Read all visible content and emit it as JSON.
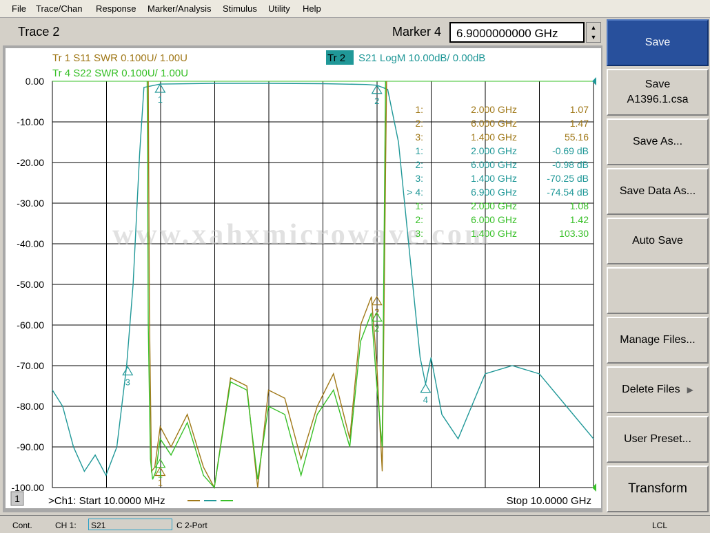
{
  "menu": [
    "File",
    "Trace/Chan",
    "Response",
    "Marker/Analysis",
    "Stimulus",
    "Utility",
    "Help"
  ],
  "header": {
    "trace_title": "Trace 2",
    "marker_label": "Marker 4",
    "marker_value": "6.9000000000 GHz"
  },
  "softkeys": [
    {
      "line1": "Save",
      "line2": ""
    },
    {
      "line1": "Save",
      "line2": "A1396.1.csa"
    },
    {
      "line1": "Save As...",
      "line2": ""
    },
    {
      "line1": "Save Data As...",
      "line2": ""
    },
    {
      "line1": "Auto Save",
      "line2": ""
    },
    {
      "line1": "",
      "line2": ""
    },
    {
      "line1": "Manage Files...",
      "line2": ""
    },
    {
      "line1": "Delete Files",
      "line2": ""
    },
    {
      "line1": "User Preset...",
      "line2": ""
    },
    {
      "line1": "Transform",
      "line2": ""
    }
  ],
  "traces": {
    "tr1": "Tr  1   S11 SWR 0.100U/  1.00U",
    "tr4": "Tr  4   S22 SWR 0.100U/  1.00U",
    "tr2_tag": "Tr  2",
    "tr2": "S21 LogM 10.00dB/  0.00dB"
  },
  "colors": {
    "s11": "#a07818",
    "s21": "#209898",
    "s22": "#38c028",
    "grid": "#000000",
    "active_key": "#28509c"
  },
  "y_axis": [
    "0.00",
    "-10.00",
    "-20.00",
    "-30.00",
    "-40.00",
    "-50.00",
    "-60.00",
    "-70.00",
    "-80.00",
    "-90.00",
    "-100.00"
  ],
  "marker_table": [
    {
      "num": "1:",
      "freq": "2.000 GHz",
      "val": "1.07",
      "trace": "s11"
    },
    {
      "num": "2:",
      "freq": "6.000 GHz",
      "val": "1.47",
      "trace": "s11"
    },
    {
      "num": "3:",
      "freq": "1.400 GHz",
      "val": "55.16",
      "trace": "s11"
    },
    {
      "num": "1:",
      "freq": "2.000 GHz",
      "val": "-0.69 dB",
      "trace": "s21"
    },
    {
      "num": "2:",
      "freq": "6.000 GHz",
      "val": "-0.98 dB",
      "trace": "s21"
    },
    {
      "num": "3:",
      "freq": "1.400 GHz",
      "val": "-70.25 dB",
      "trace": "s21"
    },
    {
      "num": "> 4:",
      "freq": "6.900 GHz",
      "val": "-74.54 dB",
      "trace": "s21"
    },
    {
      "num": "1:",
      "freq": "2.000 GHz",
      "val": "1.08",
      "trace": "s22"
    },
    {
      "num": "2:",
      "freq": "6.000 GHz",
      "val": "1.42",
      "trace": "s22"
    },
    {
      "num": "3:",
      "freq": "1.400 GHz",
      "val": "103.30",
      "trace": "s22"
    }
  ],
  "watermark": "www.xahxmicrowave.com",
  "footer": {
    "channel_badge": "1",
    "start": ">Ch1: Start  10.0000 MHz",
    "stop": "Stop  10.0000 GHz"
  },
  "status": {
    "mode": "Cont.",
    "ch": "CH 1:",
    "param": "S21",
    "cal": "C  2-Port",
    "remote": "LCL"
  },
  "chart_data": {
    "type": "line",
    "xlabel": "",
    "ylabel": "",
    "xlim": [
      0.01,
      10.0
    ],
    "ylim": [
      -100,
      0
    ],
    "grid": true,
    "series": [
      {
        "name": "S21 LogM",
        "trace": "s21",
        "x": [
          0.01,
          0.2,
          0.4,
          0.6,
          0.8,
          1.0,
          1.2,
          1.38,
          1.5,
          1.62,
          1.7,
          2.0,
          3.0,
          4.0,
          5.0,
          5.8,
          6.0,
          6.2,
          6.4,
          6.55,
          6.7,
          6.8,
          6.9,
          7.0,
          7.2,
          7.5,
          8.0,
          8.5,
          9.0,
          9.5,
          10.0
        ],
        "y": [
          -76,
          -80,
          -90,
          -96,
          -92,
          -97,
          -90,
          -70,
          -50,
          -18,
          -1.5,
          -0.7,
          -0.5,
          -0.5,
          -0.6,
          -0.8,
          -0.98,
          -2,
          -15,
          -35,
          -55,
          -68,
          -74.5,
          -68,
          -82,
          -88,
          -72,
          -70,
          -72,
          -80,
          -88
        ]
      },
      {
        "name": "S11 SWR",
        "trace": "s11",
        "x": [
          1.78,
          1.8,
          1.84,
          1.9,
          2.0,
          2.2,
          2.5,
          2.8,
          3.0,
          3.3,
          3.6,
          3.8,
          4.0,
          4.3,
          4.6,
          4.9,
          5.2,
          5.5,
          5.7,
          5.9,
          6.0,
          6.1,
          6.18
        ],
        "y": [
          0,
          -56,
          -96,
          -95,
          -85,
          -90,
          -82,
          -95,
          -101,
          -73,
          -75,
          -101,
          -76,
          -78,
          -93,
          -80,
          -72,
          -88,
          -60,
          -53,
          -70,
          -96,
          0
        ]
      },
      {
        "name": "S22 SWR",
        "trace": "s22",
        "x": [
          1.76,
          1.78,
          1.82,
          1.86,
          1.92,
          2.0,
          2.2,
          2.5,
          2.8,
          3.0,
          3.3,
          3.6,
          3.8,
          4.0,
          4.3,
          4.6,
          4.9,
          5.2,
          5.5,
          5.7,
          5.9,
          6.0,
          6.1,
          6.16
        ],
        "y": [
          0,
          -60,
          -93,
          -98,
          -96,
          -88,
          -92,
          -84,
          -97,
          -100,
          -74,
          -76,
          -98,
          -80,
          -82,
          -97,
          -82,
          -76,
          -90,
          -64,
          -57,
          -75,
          -90,
          0
        ]
      }
    ]
  }
}
